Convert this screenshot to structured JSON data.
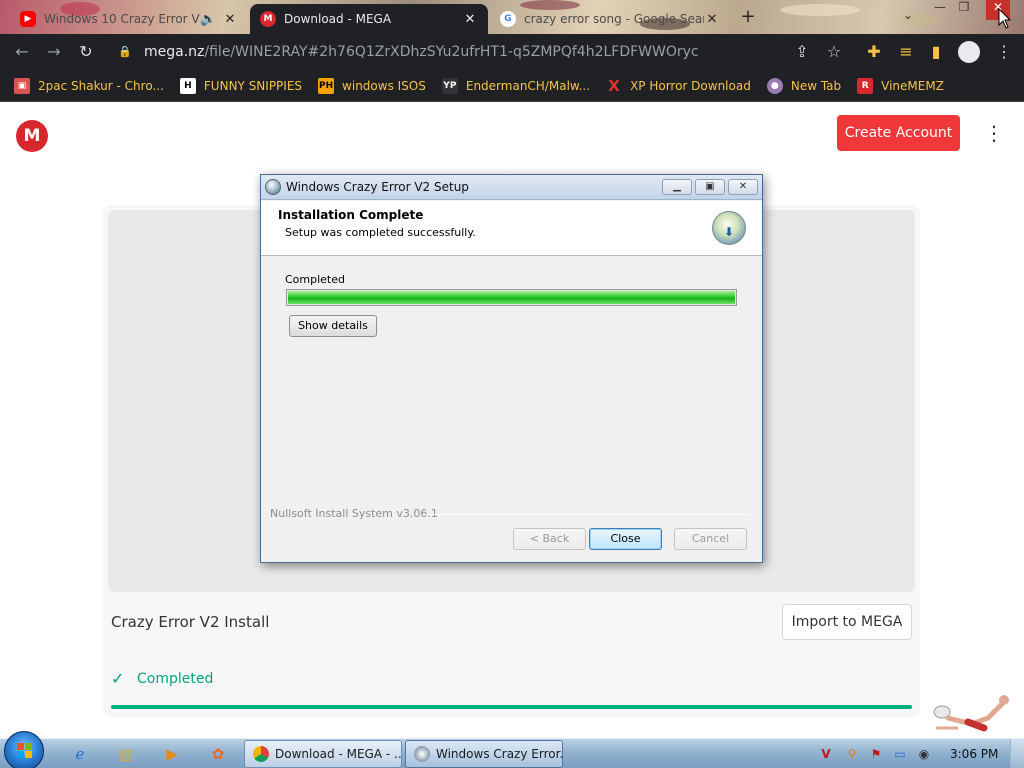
{
  "browser": {
    "tabs": [
      {
        "title": "Windows 10 Crazy Error V2",
        "favicon": "youtube-icon",
        "color": "#ff0000",
        "state": "inactive"
      },
      {
        "title": "Download - MEGA",
        "favicon": "mega-icon",
        "color": "#d9272e",
        "state": "active"
      },
      {
        "title": "crazy error song - Google Search",
        "favicon": "google-icon",
        "color": "#4285f4",
        "state": "inactive"
      }
    ],
    "new_tab_glyph": "+",
    "close_glyph": "✕",
    "url_host": "mega.nz",
    "url_path": "/file/WINE2RAY#2h76Q1ZrXDhzSYu2ufrHT1-q5ZMPQf4h2LFDFWWOryc"
  },
  "bookmarks": [
    {
      "label": "2pac Shakur - Chro...",
      "icon": "bookmark-icon"
    },
    {
      "label": "FUNNY SNIPPIES",
      "icon": "h-icon"
    },
    {
      "label": "windows ISOS",
      "icon": "ph-icon"
    },
    {
      "label": "EndermanCH/Malw...",
      "icon": "yp-icon"
    },
    {
      "label": "XP Horror Download",
      "icon": "x-icon"
    },
    {
      "label": "New Tab",
      "icon": "globe-icon"
    },
    {
      "label": "VineMEMZ",
      "icon": "r-icon"
    }
  ],
  "mega": {
    "logo_letter": "M",
    "create_account": "Create Account",
    "file_name": "Crazy Error V2 Install",
    "import_button": "Import to MEGA",
    "status": "Completed",
    "accent": "#f0373a",
    "success_color": "#00a382",
    "progress": 1.0
  },
  "installer": {
    "window_title": "Windows Crazy Error V2 Setup",
    "header_title": "Installation Complete",
    "header_subtitle": "Setup was completed successfully.",
    "status_label": "Completed",
    "progress": 1.0,
    "show_details": "Show details",
    "branding": "Nullsoft Install System v3.06.1",
    "back_button": "< Back",
    "close_button": "Close",
    "cancel_button": "Cancel"
  },
  "taskbar": {
    "tasks": [
      {
        "label": "Download - MEGA - ...",
        "icon": "chrome-icon",
        "state": "normal"
      },
      {
        "label": "Windows Crazy Error...",
        "icon": "installer-icon",
        "state": "active"
      }
    ],
    "clock": "3:06 PM"
  }
}
